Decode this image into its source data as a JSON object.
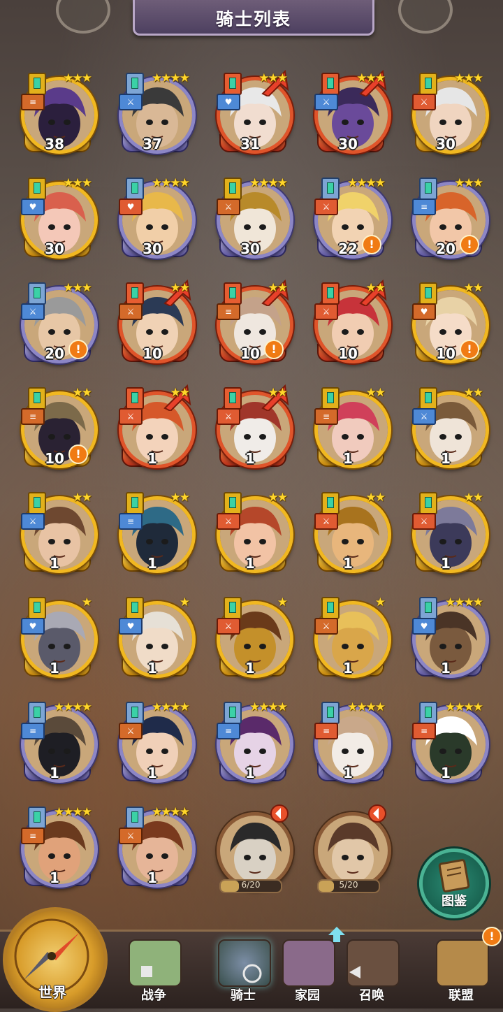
{
  "header": {
    "title": "骑士列表"
  },
  "knights": [
    {
      "level": "38",
      "stars": 3,
      "frame": "gold",
      "cls": "gold",
      "role": "orange",
      "role_sym": "≡",
      "alert": false,
      "upgrade": false,
      "skin": "#2b1f3d",
      "hair": "#5a3b8a"
    },
    {
      "level": "37",
      "stars": 4,
      "frame": "purple",
      "cls": "blue",
      "role": "blue",
      "role_sym": "⚔",
      "alert": false,
      "upgrade": false,
      "skin": "#d9b896",
      "hair": "#3a3a3a"
    },
    {
      "level": "31",
      "stars": 3,
      "frame": "red",
      "cls": "red",
      "role": "blue",
      "role_sym": "♥",
      "alert": false,
      "upgrade": true,
      "skin": "#f1ddd0",
      "hair": "#e8e8e8"
    },
    {
      "level": "30",
      "stars": 3,
      "frame": "red",
      "cls": "red",
      "role": "blue",
      "role_sym": "⚔",
      "alert": false,
      "upgrade": true,
      "skin": "#6a4a9a",
      "hair": "#3b2a5a"
    },
    {
      "level": "30",
      "stars": 3,
      "frame": "gold",
      "cls": "gold",
      "role": "red",
      "role_sym": "⚔",
      "alert": false,
      "upgrade": false,
      "skin": "#f0d5c0",
      "hair": "#e6e6e6"
    },
    {
      "level": "30",
      "stars": 3,
      "frame": "gold",
      "cls": "gold",
      "role": "blue",
      "role_sym": "♥",
      "alert": false,
      "upgrade": false,
      "skin": "#f4c8b8",
      "hair": "#d9604d"
    },
    {
      "level": "30",
      "stars": 4,
      "frame": "purple",
      "cls": "blue",
      "role": "red",
      "role_sym": "♥",
      "alert": false,
      "upgrade": false,
      "skin": "#f1cfa8",
      "hair": "#e8b84a"
    },
    {
      "level": "30",
      "stars": 4,
      "frame": "purple",
      "cls": "gold",
      "role": "orange",
      "role_sym": "⚔",
      "alert": false,
      "upgrade": false,
      "skin": "#f0e6d8",
      "hair": "#b88a2a"
    },
    {
      "level": "22",
      "stars": 4,
      "frame": "purple",
      "cls": "blue",
      "role": "red",
      "role_sym": "⚔",
      "alert": true,
      "upgrade": false,
      "skin": "#f2d3b3",
      "hair": "#f0d26a"
    },
    {
      "level": "20",
      "stars": 3,
      "frame": "purple",
      "cls": "blue",
      "role": "blue",
      "role_sym": "≡",
      "alert": true,
      "upgrade": false,
      "skin": "#f2c7a8",
      "hair": "#d8642a"
    },
    {
      "level": "20",
      "stars": 3,
      "frame": "purple",
      "cls": "blue",
      "role": "blue",
      "role_sym": "⚔",
      "alert": true,
      "upgrade": false,
      "skin": "#e7c7a6",
      "hair": "#9a9a9a"
    },
    {
      "level": "10",
      "stars": 2,
      "frame": "red",
      "cls": "red",
      "role": "orange",
      "role_sym": "⚔",
      "alert": false,
      "upgrade": true,
      "skin": "#f0d2b5",
      "hair": "#2b3a55"
    },
    {
      "level": "10",
      "stars": 2,
      "frame": "red",
      "cls": "red",
      "role": "orange",
      "role_sym": "≡",
      "alert": true,
      "upgrade": true,
      "skin": "#efe7df",
      "hair": "#c4a28a"
    },
    {
      "level": "10",
      "stars": 2,
      "frame": "red",
      "cls": "red",
      "role": "red",
      "role_sym": "⚔",
      "alert": false,
      "upgrade": true,
      "skin": "#f1cdb2",
      "hair": "#c7333a"
    },
    {
      "level": "10",
      "stars": 2,
      "frame": "gold",
      "cls": "gold",
      "role": "orange",
      "role_sym": "♥",
      "alert": true,
      "upgrade": false,
      "skin": "#f5dcc8",
      "hair": "#e8d2a6"
    },
    {
      "level": "10",
      "stars": 2,
      "frame": "gold",
      "cls": "gold",
      "role": "orange",
      "role_sym": "≡",
      "alert": true,
      "upgrade": false,
      "skin": "#2a2233",
      "hair": "#7c6a4a"
    },
    {
      "level": "1",
      "stars": 2,
      "frame": "red",
      "cls": "red",
      "role": "red",
      "role_sym": "⚔",
      "alert": false,
      "upgrade": true,
      "skin": "#f3d3bb",
      "hair": "#d6582a"
    },
    {
      "level": "1",
      "stars": 2,
      "frame": "red",
      "cls": "red",
      "role": "red",
      "role_sym": "⚔",
      "alert": false,
      "upgrade": true,
      "skin": "#f0ece8",
      "hair": "#a0362a"
    },
    {
      "level": "1",
      "stars": 2,
      "frame": "gold",
      "cls": "gold",
      "role": "orange",
      "role_sym": "≡",
      "alert": false,
      "upgrade": false,
      "skin": "#f1cbbe",
      "hair": "#d0405a"
    },
    {
      "level": "1",
      "stars": 2,
      "frame": "gold",
      "cls": "gold",
      "role": "blue",
      "role_sym": "⚔",
      "alert": false,
      "upgrade": false,
      "skin": "#efe4d8",
      "hair": "#7a5a3a"
    },
    {
      "level": "1",
      "stars": 2,
      "frame": "gold",
      "cls": "gold",
      "role": "blue",
      "role_sym": "⚔",
      "alert": false,
      "upgrade": false,
      "skin": "#e8c3a4",
      "hair": "#6e4830"
    },
    {
      "level": "1",
      "stars": 2,
      "frame": "gold",
      "cls": "gold",
      "role": "blue",
      "role_sym": "≡",
      "alert": false,
      "upgrade": false,
      "skin": "#1f2a3a",
      "hair": "#2e6a86"
    },
    {
      "level": "1",
      "stars": 2,
      "frame": "gold",
      "cls": "gold",
      "role": "red",
      "role_sym": "⚔",
      "alert": false,
      "upgrade": false,
      "skin": "#f2c3a5",
      "hair": "#b5472a"
    },
    {
      "level": "1",
      "stars": 2,
      "frame": "gold",
      "cls": "gold",
      "role": "red",
      "role_sym": "⚔",
      "alert": false,
      "upgrade": false,
      "skin": "#e8b67c",
      "hair": "#a8731e"
    },
    {
      "level": "1",
      "stars": 2,
      "frame": "gold",
      "cls": "gold",
      "role": "red",
      "role_sym": "⚔",
      "alert": false,
      "upgrade": false,
      "skin": "#3c3a5a",
      "hair": "#7d7a9a"
    },
    {
      "level": "1",
      "stars": 1,
      "frame": "gold",
      "cls": "gold",
      "role": "blue",
      "role_sym": "♥",
      "alert": false,
      "upgrade": false,
      "skin": "#5a5a6a",
      "hair": "#a9a9b4"
    },
    {
      "level": "1",
      "stars": 1,
      "frame": "gold",
      "cls": "gold",
      "role": "blue",
      "role_sym": "♥",
      "alert": false,
      "upgrade": false,
      "skin": "#f0dcc8",
      "hair": "#e6e0d6"
    },
    {
      "level": "1",
      "stars": 1,
      "frame": "gold",
      "cls": "gold",
      "role": "red",
      "role_sym": "⚔",
      "alert": false,
      "upgrade": false,
      "skin": "#c4902a",
      "hair": "#6a3a1a"
    },
    {
      "level": "1",
      "stars": 1,
      "frame": "gold",
      "cls": "gold",
      "role": "orange",
      "role_sym": "⚔",
      "alert": false,
      "upgrade": false,
      "skin": "#d9a64a",
      "hair": "#e8c05a"
    },
    {
      "level": "1",
      "stars": 4,
      "frame": "purple",
      "cls": "blue",
      "role": "blue",
      "role_sym": "♥",
      "alert": false,
      "upgrade": false,
      "skin": "#7a5a3e",
      "hair": "#4a3426"
    },
    {
      "level": "1",
      "stars": 4,
      "frame": "purple",
      "cls": "blue",
      "role": "blue",
      "role_sym": "≡",
      "alert": false,
      "upgrade": false,
      "skin": "#1e1e24",
      "hair": "#5a4a3a"
    },
    {
      "level": "1",
      "stars": 4,
      "frame": "purple",
      "cls": "blue",
      "role": "orange",
      "role_sym": "⚔",
      "alert": false,
      "upgrade": false,
      "skin": "#f0d0b8",
      "hair": "#1f2b4a"
    },
    {
      "level": "1",
      "stars": 4,
      "frame": "purple",
      "cls": "blue",
      "role": "blue",
      "role_sym": "≡",
      "alert": false,
      "upgrade": false,
      "skin": "#e6d3e6",
      "hair": "#5a2a6a"
    },
    {
      "level": "1",
      "stars": 4,
      "frame": "purple",
      "cls": "blue",
      "role": "red",
      "role_sym": "≡",
      "alert": false,
      "upgrade": false,
      "skin": "#f2ece6",
      "hair": "#c9a88a"
    },
    {
      "level": "1",
      "stars": 4,
      "frame": "purple",
      "cls": "blue",
      "role": "red",
      "role_sym": "≡",
      "alert": false,
      "upgrade": false,
      "skin": "#2a3a2a",
      "hair": "#ffffff"
    },
    {
      "level": "1",
      "stars": 4,
      "frame": "purple",
      "cls": "blue",
      "role": "orange",
      "role_sym": "≡",
      "alert": false,
      "upgrade": false,
      "skin": "#e0a27a",
      "hair": "#6a3a1e"
    },
    {
      "level": "1",
      "stars": 4,
      "frame": "purple",
      "cls": "blue",
      "role": "orange",
      "role_sym": "⚔",
      "alert": false,
      "upgrade": false,
      "skin": "#e6b598",
      "hair": "#7a3a1e"
    }
  ],
  "shards": [
    {
      "progress": "6/20",
      "fraction": 0.3,
      "skin": "#d9d1c4",
      "hair": "#2a2a2a"
    },
    {
      "progress": "5/20",
      "fraction": 0.25,
      "skin": "#e1c7a8",
      "hair": "#5a3a2a"
    }
  ],
  "codex": {
    "label": "图鉴"
  },
  "nav": {
    "world": "世界",
    "items": [
      {
        "label": "战争",
        "icon": "map-icon",
        "active": false
      },
      {
        "label": "骑士",
        "icon": "knight-icon",
        "active": true
      },
      {
        "label": "家园",
        "icon": "house-icon",
        "active": false
      },
      {
        "label": "召唤",
        "icon": "train-icon",
        "active": false
      },
      {
        "label": "联盟",
        "icon": "guild-icon",
        "active": false
      }
    ],
    "badge": "!"
  },
  "alert_mark": "!",
  "colors": {
    "gold_frame": "#f1b820",
    "purple_frame": "#8c86c6",
    "red_frame": "#e0542a",
    "alert": "#f07b14",
    "codex": "#2b8a73"
  }
}
